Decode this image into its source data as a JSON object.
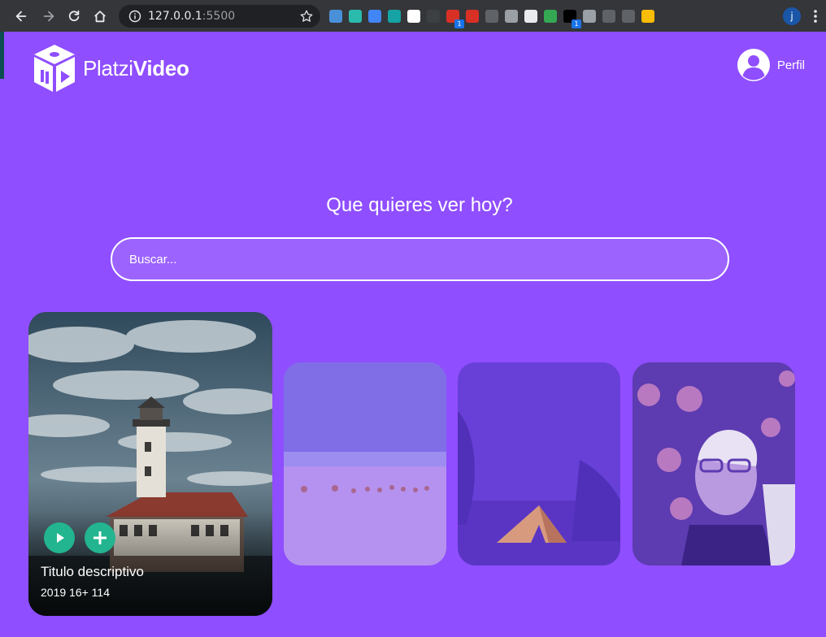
{
  "browser": {
    "url_host": "127.0.0.1",
    "url_port": ":5500",
    "profile_initial": "j",
    "extensions": [
      {
        "name": "pen-extension-icon",
        "color": "#4a90d9",
        "badge": ""
      },
      {
        "name": "cloud-extension-icon",
        "color": "#2bbbad",
        "badge": ""
      },
      {
        "name": "calendar-extension-icon",
        "color": "#4285f4",
        "badge": ""
      },
      {
        "name": "chat-extension-icon",
        "color": "#15a3a3",
        "badge": ""
      },
      {
        "name": "note-extension-icon",
        "color": "#ffffff",
        "badge": ""
      },
      {
        "name": "more-extension-icon",
        "color": "#3c4043",
        "badge": ""
      },
      {
        "name": "cross-extension-icon",
        "color": "#d93025",
        "badge": "1"
      },
      {
        "name": "pin-extension-icon",
        "color": "#d93025",
        "badge": ""
      },
      {
        "name": "chat2-extension-icon",
        "color": "#5f6368",
        "badge": ""
      },
      {
        "name": "vue-extension-icon",
        "color": "#9aa0a6",
        "badge": ""
      },
      {
        "name": "circle-extension-icon",
        "color": "#e8eaed",
        "badge": ""
      },
      {
        "name": "mail-check-extension-icon",
        "color": "#34a853",
        "badge": ""
      },
      {
        "name": "camera-extension-icon",
        "color": "#000000",
        "badge": "1"
      },
      {
        "name": "script-extension-icon",
        "color": "#9aa0a6",
        "badge": ""
      },
      {
        "name": "code-extension-icon",
        "color": "#5f6368",
        "badge": ""
      },
      {
        "name": "g-extension-icon",
        "color": "#5f6368",
        "badge": ""
      },
      {
        "name": "palette-extension-icon",
        "color": "#fbbc04",
        "badge": ""
      }
    ]
  },
  "header": {
    "logo_light": "Platzi",
    "logo_bold": "Video",
    "profile_label": "Perfil"
  },
  "hero": {
    "headline": "Que quieres ver hoy?",
    "search_placeholder": "Buscar..."
  },
  "carousel": {
    "featured": {
      "title": "Titulo descriptivo",
      "meta": "2019 16+ 114"
    }
  },
  "colors": {
    "background": "#8f4eff",
    "accent": "#22b58f"
  }
}
